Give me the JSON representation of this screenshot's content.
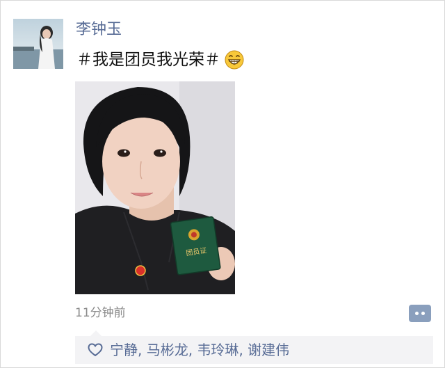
{
  "post": {
    "author": "李钟玉",
    "text": "＃我是团员我光荣＃",
    "emoji": "grinning-face-icon",
    "timestamp": "11分钟前",
    "photo_badge_text": "团员证"
  },
  "actions": {
    "comment_icon": "comment-dots-icon"
  },
  "likes": {
    "icon": "heart-outline-icon",
    "names": [
      "宁静",
      "马彬龙",
      "韦玲琳",
      "谢建伟"
    ],
    "separator": ", "
  },
  "colors": {
    "link": "#576b95",
    "timestamp": "#8a8a8a",
    "likes_bg": "#f3f3f5",
    "comment_button": "#8a9fbd"
  }
}
